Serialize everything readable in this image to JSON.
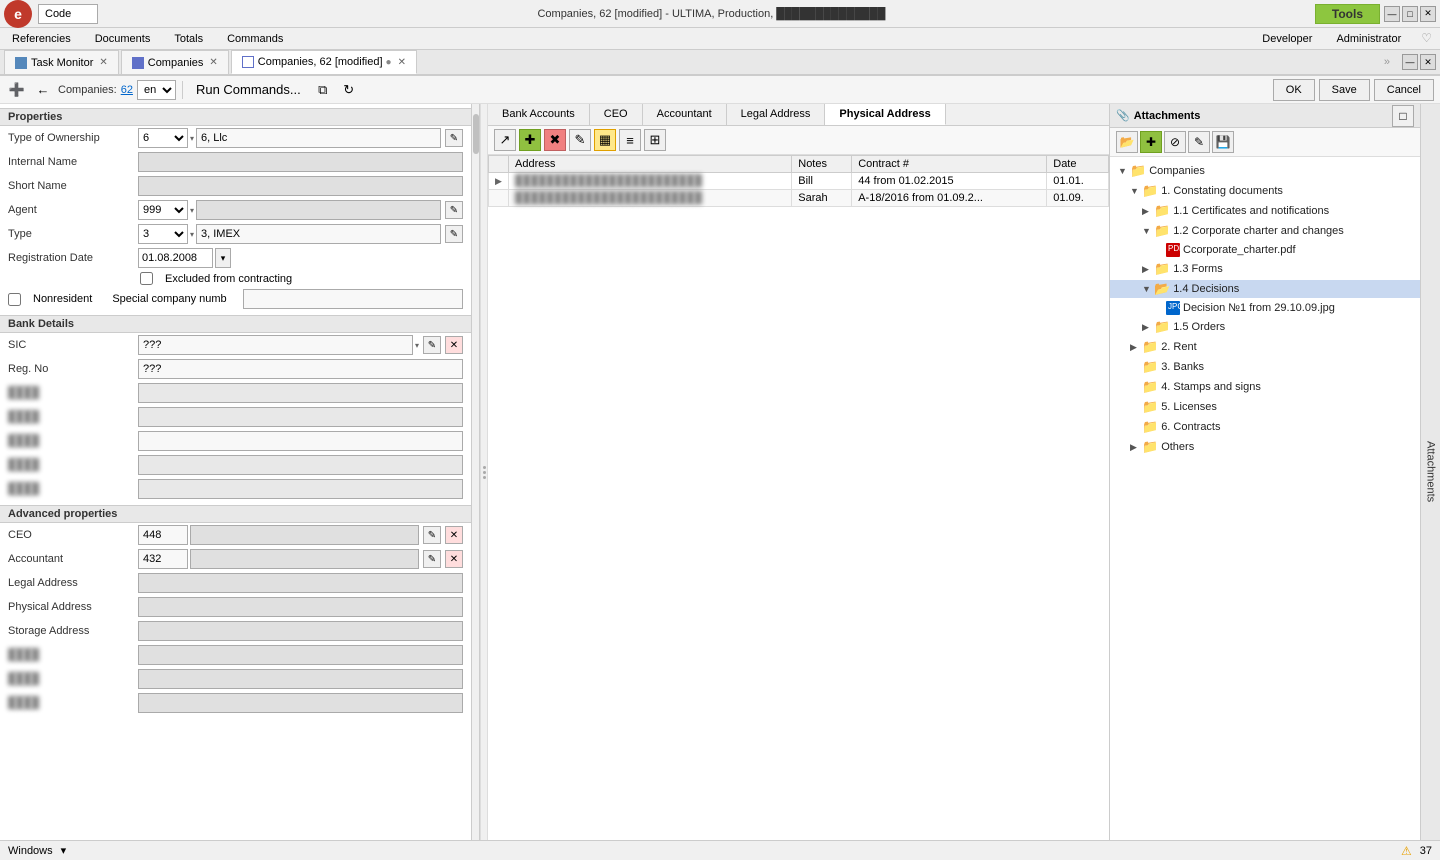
{
  "window": {
    "title": "Companies, 62 [modified] - ULTIMA, Production, ██████████████",
    "code_label": "Code",
    "logo": "e"
  },
  "tools": {
    "label": "Tools",
    "developer": "Developer",
    "administrator": "Administrator"
  },
  "menu": {
    "items": [
      "Referencіes",
      "Documents",
      "Totals",
      "Commands"
    ]
  },
  "tabs": [
    {
      "label": "Task Monitor",
      "icon": "monitor",
      "closeable": true
    },
    {
      "label": "Companies",
      "icon": "table",
      "closeable": true
    },
    {
      "label": "Companies, 62 [modified]",
      "icon": "doc",
      "closeable": true,
      "active": true
    }
  ],
  "toolbar": {
    "companies_label": "Companies:",
    "companies_num": "62",
    "lang": "en",
    "run_commands": "Run Commands...",
    "ok_label": "OK",
    "save_label": "Save",
    "cancel_label": "Cancel"
  },
  "left_panel": {
    "properties_header": "Properties",
    "type_of_ownership_label": "Type of Ownership",
    "type_of_ownership_val": "6",
    "type_of_ownership_text": "6, Llc",
    "internal_name_label": "Internal Name",
    "short_name_label": "Short Name",
    "agent_label": "Agent",
    "agent_val": "999",
    "type_label": "Type",
    "type_val": "3",
    "type_text": "3, IMEX",
    "reg_date_label": "Registration Date",
    "reg_date_val": "01.08.2008",
    "excluded_label": "Excluded from contracting",
    "nonresident_label": "Nonresident",
    "special_label": "Special company numb",
    "bank_details_header": "Bank Details",
    "sic_label": "SIC",
    "sic_val": "???",
    "reg_no_label": "Reg. No",
    "reg_no_val": "???",
    "advanced_header": "Advanced properties",
    "ceo_label": "CEO",
    "ceo_val": "448",
    "accountant_label": "Accountant",
    "accountant_val": "432",
    "legal_address_label": "Legal Address",
    "physical_address_label": "Physical Address",
    "storage_address_label": "Storage Address"
  },
  "middle_panel": {
    "tabs": [
      {
        "label": "Bank Accounts",
        "active": false
      },
      {
        "label": "CEO",
        "active": false
      },
      {
        "label": "Accountant",
        "active": false
      },
      {
        "label": "Legal Address",
        "active": false
      },
      {
        "label": "Physical Address",
        "active": true
      }
    ],
    "table": {
      "columns": [
        "Address",
        "Notes",
        "Contract #",
        "Date"
      ],
      "rows": [
        {
          "address": "██████████████████████",
          "notes": "Bill",
          "contract": "44 from 01.02.2015",
          "date": "01.01."
        },
        {
          "address": "██████████████████████",
          "notes": "Sarah",
          "contract": "A-18/2016 from 01.09.2...",
          "date": "01.09."
        }
      ]
    }
  },
  "attachments": {
    "title": "Attachments",
    "tree": {
      "root": "Companies",
      "children": [
        {
          "label": "1. Constating documents",
          "expanded": true,
          "children": [
            {
              "label": "1.1 Certificates and notifications",
              "expanded": false,
              "children": []
            },
            {
              "label": "1.2 Corporate charter and changes",
              "expanded": true,
              "children": [
                {
                  "label": "Ccorporate_charter.pdf",
                  "type": "pdf"
                }
              ]
            },
            {
              "label": "1.3 Forms",
              "expanded": false,
              "children": []
            },
            {
              "label": "1.4 Decisions",
              "expanded": true,
              "selected": true,
              "children": [
                {
                  "label": "Decision №1 from 29.10.09.jpg",
                  "type": "jpg"
                }
              ]
            },
            {
              "label": "1.5 Orders",
              "expanded": false,
              "children": []
            }
          ]
        },
        {
          "label": "2. Rent",
          "expanded": false
        },
        {
          "label": "3. Banks",
          "expanded": false
        },
        {
          "label": "4. Stamps and signs",
          "expanded": false
        },
        {
          "label": "5. Licenses",
          "expanded": false
        },
        {
          "label": "6. Contracts",
          "expanded": false
        },
        {
          "label": "Others",
          "expanded": false
        }
      ]
    }
  },
  "status_bar": {
    "windows_label": "Windows",
    "warning_count": "37"
  },
  "icons": {
    "folder": "📁",
    "folder_open": "📂",
    "pdf": "PDF",
    "jpg": "JPG",
    "chevron_right": "▶",
    "chevron_down": "▼",
    "add": "✚",
    "remove": "✖",
    "edit": "✎",
    "refresh": "↻",
    "save": "💾",
    "back": "←",
    "forward": "→",
    "up": "▲",
    "down": "▼",
    "close": "✕",
    "maximize": "□",
    "minimize": "—",
    "grid": "▦",
    "list": "≡",
    "star": "★"
  }
}
